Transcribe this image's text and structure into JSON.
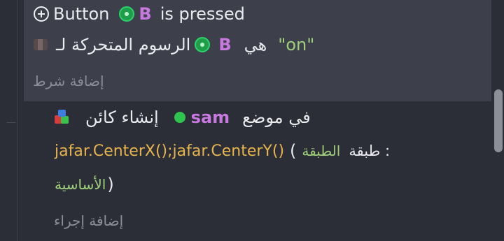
{
  "condition": {
    "line1": {
      "button_word": "Button",
      "object_name": "B",
      "suffix": "is pressed"
    },
    "line2": {
      "prefix": "الرسوم المتحركة لـ",
      "object_name": "B",
      "verb": "هي",
      "value": "\"on\""
    },
    "add_condition_label": "إضافة شرط"
  },
  "action": {
    "line1": {
      "location_word": "في موضع",
      "object_name": "sam",
      "create_label": "إنشاء كائن"
    },
    "line2": {
      "layer_label": "طبقة :",
      "layer_value": "الطبقة",
      "open_paren": "(",
      "expression": "jafar.CenterX();jafar.CenterY()",
      "space": " "
    },
    "line3": {
      "layer_value_cont": "الأساسية",
      "close_paren": ")"
    },
    "add_action_label": "إضافة إجراء"
  },
  "colors": {
    "object_name": "#c779df",
    "string_value": "#9fcf7a",
    "expression": "#e7b34c",
    "object_icon": "#1f9d4b",
    "panel": "#3d404a",
    "background": "#2b2e36"
  },
  "icons": {
    "gamepad": "gamepad-icon",
    "object": "object-icon",
    "layer": "layer-icon",
    "create": "create-object-icon",
    "sam_dot": "green-dot-icon"
  }
}
